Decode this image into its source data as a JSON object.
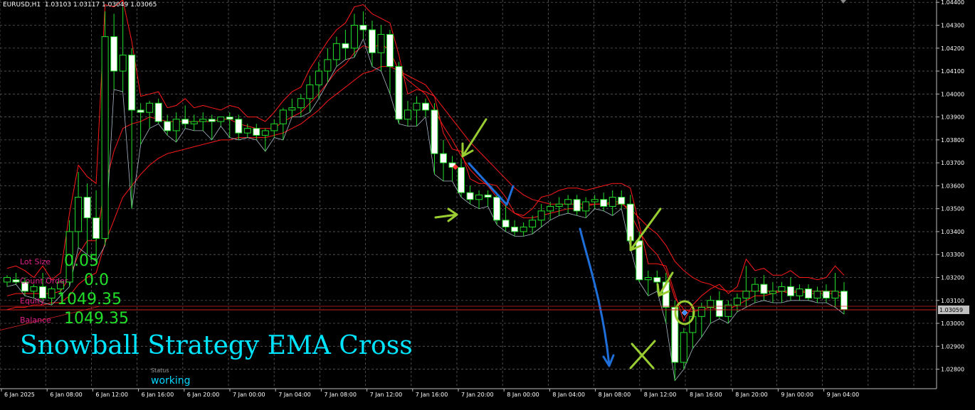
{
  "header": {
    "symbol": "EURUSD,H1",
    "ohlc": "1.03103 1.03117 1.03049 1.03065"
  },
  "panel": {
    "lot_size_label": "Lot Size",
    "lot_size_value": "0.05",
    "count_order_label": "Count Order",
    "count_order_value": "0.0",
    "equity_label": "Equity",
    "equity_value": "1049.35",
    "balance_label": "Balance",
    "balance_value": "1049.35"
  },
  "strategy_title": "Snowball Strategy EMA Cross",
  "status": {
    "label": "Status",
    "value": "working"
  },
  "current_price_label": "1.03059",
  "colors": {
    "background": "#000000",
    "grid": "#5a5a5a",
    "bull_candle": "#000000",
    "bear_candle": "#ffffff",
    "wick": "#22e02a",
    "ema_line": "#ff1a1a",
    "price_line": "#cc2222",
    "title": "#00e5ff",
    "annotation_arrow_green": "#9acd32",
    "annotation_arrow_blue": "#1e6fd9"
  },
  "chart_data": {
    "type": "candlestick",
    "ylim": [
      1.0273,
      1.044
    ],
    "y_ticks": [
      "1.04400",
      "1.04300",
      "1.04200",
      "1.04100",
      "1.04000",
      "1.03900",
      "1.03800",
      "1.03700",
      "1.03600",
      "1.03500",
      "1.03400",
      "1.03300",
      "1.03200",
      "1.03100",
      "1.03000",
      "1.02900",
      "1.02800"
    ],
    "x_ticks": [
      "6 Jan 2025",
      "6 Jan 08:00",
      "6 Jan 12:00",
      "6 Jan 16:00",
      "6 Jan 20:00",
      "7 Jan 00:00",
      "7 Jan 04:00",
      "7 Jan 08:00",
      "7 Jan 12:00",
      "7 Jan 16:00",
      "7 Jan 20:00",
      "8 Jan 00:00",
      "8 Jan 04:00",
      "8 Jan 08:00",
      "8 Jan 12:00",
      "8 Jan 16:00",
      "8 Jan 20:00",
      "9 Jan 00:00",
      "9 Jan 04:00"
    ],
    "candles": [
      [
        1.0318,
        1.0321,
        1.0316,
        1.032
      ],
      [
        1.0319,
        1.0322,
        1.0317,
        1.0318
      ],
      [
        1.0318,
        1.032,
        1.0312,
        1.0314
      ],
      [
        1.0314,
        1.0317,
        1.0311,
        1.0316
      ],
      [
        1.0316,
        1.0322,
        1.0309,
        1.0311
      ],
      [
        1.0311,
        1.0316,
        1.0308,
        1.0315
      ],
      [
        1.0315,
        1.0319,
        1.0312,
        1.0318
      ],
      [
        1.0318,
        1.0345,
        1.0316,
        1.034
      ],
      [
        1.034,
        1.0366,
        1.0333,
        1.0355
      ],
      [
        1.0355,
        1.0361,
        1.033,
        1.0346
      ],
      [
        1.0346,
        1.0358,
        1.0327,
        1.0337
      ],
      [
        1.0337,
        1.0436,
        1.0334,
        1.0425
      ],
      [
        1.0425,
        1.0435,
        1.0402,
        1.041
      ],
      [
        1.041,
        1.0438,
        1.0401,
        1.0417
      ],
      [
        1.0417,
        1.042,
        1.035,
        1.0393
      ],
      [
        1.0393,
        1.0396,
        1.0378,
        1.0392
      ],
      [
        1.0392,
        1.0397,
        1.0385,
        1.0396
      ],
      [
        1.0396,
        1.0398,
        1.0387,
        1.0388
      ],
      [
        1.0388,
        1.0391,
        1.0382,
        1.0384
      ],
      [
        1.0384,
        1.0392,
        1.0379,
        1.0389
      ],
      [
        1.0389,
        1.0395,
        1.0385,
        1.0387
      ],
      [
        1.0387,
        1.0391,
        1.0384,
        1.0388
      ],
      [
        1.0388,
        1.0392,
        1.0384,
        1.0389
      ],
      [
        1.0389,
        1.0391,
        1.038,
        1.0388
      ],
      [
        1.0388,
        1.039,
        1.0386,
        1.039
      ],
      [
        1.039,
        1.0392,
        1.0381,
        1.0389
      ],
      [
        1.0389,
        1.0391,
        1.038,
        1.0383
      ],
      [
        1.0383,
        1.0387,
        1.0381,
        1.0385
      ],
      [
        1.0385,
        1.0387,
        1.038,
        1.0382
      ],
      [
        1.0382,
        1.0385,
        1.0375,
        1.0384
      ],
      [
        1.0384,
        1.0389,
        1.0381,
        1.0387
      ],
      [
        1.0387,
        1.0394,
        1.038,
        1.0393
      ],
      [
        1.0393,
        1.0398,
        1.039,
        1.0394
      ],
      [
        1.0394,
        1.04,
        1.039,
        1.0398
      ],
      [
        1.0398,
        1.0408,
        1.0392,
        1.0404
      ],
      [
        1.0404,
        1.0414,
        1.0398,
        1.041
      ],
      [
        1.041,
        1.042,
        1.0405,
        1.0415
      ],
      [
        1.0415,
        1.0425,
        1.0412,
        1.0422
      ],
      [
        1.0422,
        1.0428,
        1.0415,
        1.042
      ],
      [
        1.042,
        1.0435,
        1.0416,
        1.043
      ],
      [
        1.043,
        1.0436,
        1.0424,
        1.0428
      ],
      [
        1.0428,
        1.0432,
        1.0412,
        1.0418
      ],
      [
        1.0418,
        1.043,
        1.041,
        1.0426
      ],
      [
        1.0426,
        1.0428,
        1.04,
        1.0412
      ],
      [
        1.0412,
        1.0414,
        1.0387,
        1.0389
      ],
      [
        1.0389,
        1.0397,
        1.0386,
        1.0393
      ],
      [
        1.0393,
        1.0399,
        1.0386,
        1.0396
      ],
      [
        1.0396,
        1.0398,
        1.039,
        1.0393
      ],
      [
        1.0393,
        1.0396,
        1.0365,
        1.0374
      ],
      [
        1.0374,
        1.038,
        1.0362,
        1.037
      ],
      [
        1.037,
        1.0373,
        1.0362,
        1.0368
      ],
      [
        1.0368,
        1.0372,
        1.0355,
        1.0357
      ],
      [
        1.0357,
        1.036,
        1.0352,
        1.0354
      ],
      [
        1.0354,
        1.0358,
        1.035,
        1.0356
      ],
      [
        1.0356,
        1.0358,
        1.0351,
        1.0355
      ],
      [
        1.0355,
        1.0357,
        1.0343,
        1.0345
      ],
      [
        1.0345,
        1.0352,
        1.034,
        1.0342
      ],
      [
        1.0342,
        1.0345,
        1.0338,
        1.034
      ],
      [
        1.034,
        1.0344,
        1.0338,
        1.0342
      ],
      [
        1.0342,
        1.0347,
        1.0339,
        1.0345
      ],
      [
        1.0345,
        1.0352,
        1.0342,
        1.0349
      ],
      [
        1.0349,
        1.0353,
        1.0345,
        1.0351
      ],
      [
        1.0351,
        1.0355,
        1.0347,
        1.0352
      ],
      [
        1.0352,
        1.0356,
        1.0348,
        1.0354
      ],
      [
        1.0354,
        1.0356,
        1.0347,
        1.0349
      ],
      [
        1.0349,
        1.0355,
        1.0346,
        1.0353
      ],
      [
        1.0353,
        1.0356,
        1.035,
        1.0354
      ],
      [
        1.0354,
        1.0357,
        1.0349,
        1.0351
      ],
      [
        1.0351,
        1.0358,
        1.0347,
        1.0355
      ],
      [
        1.0355,
        1.0358,
        1.035,
        1.0352
      ],
      [
        1.0352,
        1.0356,
        1.0333,
        1.0336
      ],
      [
        1.0336,
        1.034,
        1.0318,
        1.0319
      ],
      [
        1.0319,
        1.0323,
        1.0312,
        1.032
      ],
      [
        1.032,
        1.0323,
        1.0314,
        1.0318
      ],
      [
        1.0318,
        1.0322,
        1.03,
        1.0307
      ],
      [
        1.0307,
        1.031,
        1.0275,
        1.0283
      ],
      [
        1.0283,
        1.0298,
        1.028,
        1.0296
      ],
      [
        1.0296,
        1.0305,
        1.0289,
        1.0303
      ],
      [
        1.0303,
        1.0309,
        1.0294,
        1.0307
      ],
      [
        1.0307,
        1.0312,
        1.03,
        1.031
      ],
      [
        1.031,
        1.0314,
        1.0302,
        1.0303
      ],
      [
        1.0303,
        1.031,
        1.03,
        1.0308
      ],
      [
        1.0308,
        1.0313,
        1.0305,
        1.0311
      ],
      [
        1.0311,
        1.0325,
        1.0307,
        1.0314
      ],
      [
        1.0314,
        1.032,
        1.0309,
        1.0317
      ],
      [
        1.0317,
        1.0321,
        1.031,
        1.0313
      ],
      [
        1.0313,
        1.0318,
        1.0309,
        1.0314
      ],
      [
        1.0314,
        1.0318,
        1.0309,
        1.0316
      ],
      [
        1.0316,
        1.032,
        1.031,
        1.0312
      ],
      [
        1.0312,
        1.0317,
        1.031,
        1.0315
      ],
      [
        1.0315,
        1.0317,
        1.031,
        1.0311
      ],
      [
        1.0311,
        1.0316,
        1.0309,
        1.0314
      ],
      [
        1.0314,
        1.0317,
        1.0309,
        1.0311
      ],
      [
        1.0311,
        1.0322,
        1.0307,
        1.0314
      ],
      [
        1.0314,
        1.0318,
        1.0304,
        1.0306
      ]
    ],
    "ema_fast": [
      1.0312,
      1.0313,
      1.0313,
      1.0313,
      1.0313,
      1.0313,
      1.0314,
      1.032,
      1.033,
      1.0336,
      1.0336,
      1.036,
      1.0375,
      1.0385,
      1.0387,
      1.0388,
      1.039,
      1.0389,
      1.0388,
      1.0388,
      1.0388,
      1.0388,
      1.0388,
      1.0388,
      1.0389,
      1.0389,
      1.0387,
      1.0386,
      1.0385,
      1.0385,
      1.0385,
      1.0388,
      1.039,
      1.0392,
      1.0396,
      1.04,
      1.0405,
      1.041,
      1.0413,
      1.0418,
      1.0421,
      1.042,
      1.0422,
      1.0419,
      1.041,
      1.0406,
      1.0403,
      1.04,
      1.0393,
      1.0386,
      1.038,
      1.0373,
      1.0367,
      1.0363,
      1.036,
      1.0355,
      1.0351,
      1.0348,
      1.0346,
      1.0346,
      1.0347,
      1.0348,
      1.0349,
      1.035,
      1.035,
      1.0351,
      1.0352,
      1.0352,
      1.0353,
      1.0353,
      1.0348,
      1.034,
      1.0334,
      1.033,
      1.0323,
      1.0311,
      1.0306,
      1.0305,
      1.0306,
      1.0307,
      1.0306,
      1.0306,
      1.0308,
      1.031,
      1.0312,
      1.0312,
      1.0313,
      1.0314,
      1.0313,
      1.0314,
      1.0313,
      1.0313,
      1.0313,
      1.0313,
      1.0311
    ],
    "ema_slow": [
      1.0306,
      1.0307,
      1.0307,
      1.0308,
      1.0308,
      1.0309,
      1.0309,
      1.0312,
      1.0317,
      1.032,
      1.0322,
      1.0335,
      1.0345,
      1.0355,
      1.036,
      1.0365,
      1.0369,
      1.0372,
      1.0374,
      1.0375,
      1.0376,
      1.0377,
      1.0378,
      1.0379,
      1.038,
      1.038,
      1.0381,
      1.0381,
      1.0381,
      1.0381,
      1.0382,
      1.0383,
      1.0385,
      1.0387,
      1.039,
      1.0393,
      1.0397,
      1.04,
      1.0403,
      1.0406,
      1.0409,
      1.041,
      1.0412,
      1.0412,
      1.041,
      1.0408,
      1.0406,
      1.0404,
      1.0399,
      1.0394,
      1.0389,
      1.0384,
      1.0379,
      1.0375,
      1.0371,
      1.0367,
      1.0363,
      1.0359,
      1.0356,
      1.0354,
      1.0353,
      1.0352,
      1.0352,
      1.0352,
      1.0352,
      1.0352,
      1.0352,
      1.0352,
      1.0352,
      1.0352,
      1.035,
      1.0346,
      1.0342,
      1.0339,
      1.0334,
      1.0327,
      1.0323,
      1.032,
      1.0318,
      1.0317,
      1.0315,
      1.0314,
      1.0314,
      1.0314,
      1.0314,
      1.0314,
      1.0314,
      1.0314,
      1.0314,
      1.0314,
      1.0314,
      1.0314,
      1.0314,
      1.0314,
      1.0313
    ]
  }
}
